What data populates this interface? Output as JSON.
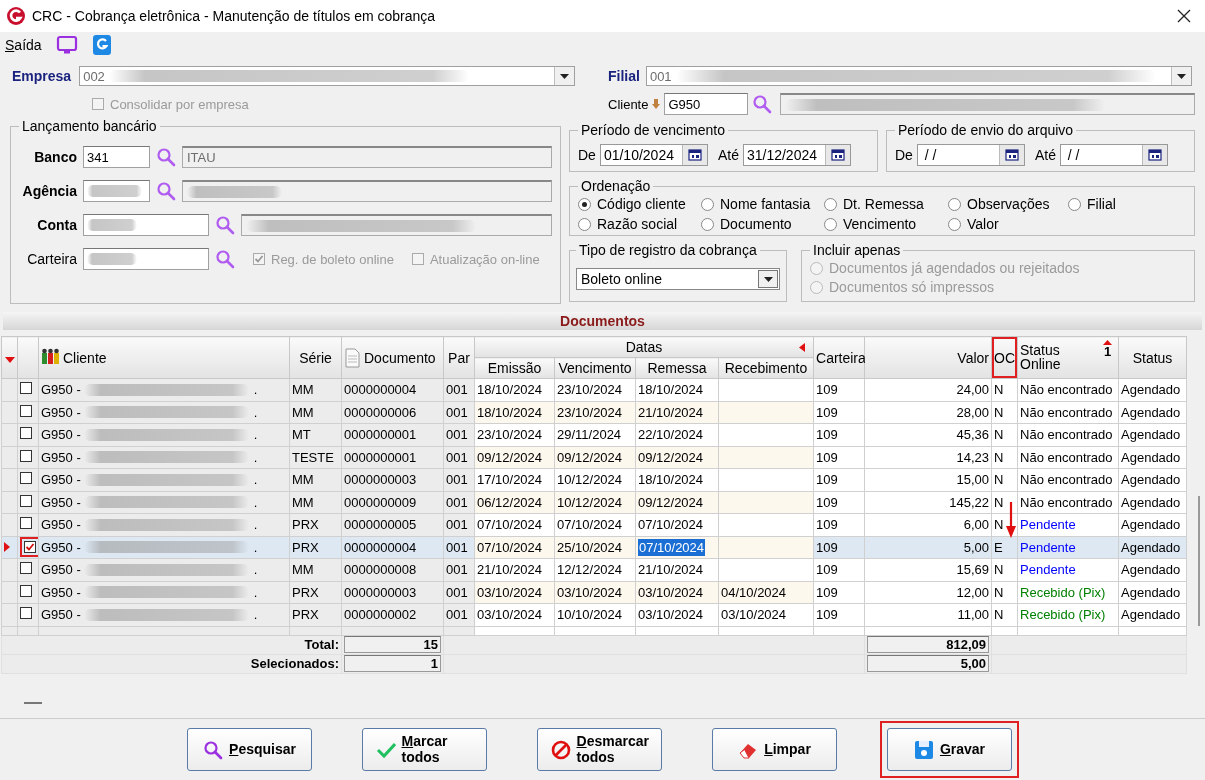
{
  "window": {
    "title": "CRC - Cobrança eletrônica - Manutenção de títulos em cobrança"
  },
  "menu": {
    "items": [
      {
        "label": "Saída",
        "kind": "text"
      },
      {
        "kind": "monitor"
      },
      {
        "kind": "logo"
      }
    ]
  },
  "empresa": {
    "label": "Empresa",
    "value": "002"
  },
  "filial": {
    "label": "Filial",
    "value": "001"
  },
  "consolidar": {
    "label": "Consolidar por empresa",
    "checked": false,
    "disabled": true
  },
  "cliente": {
    "label": "Cliente",
    "value": "G950"
  },
  "lancamento": {
    "title": "Lançamento bancário",
    "fields": [
      {
        "label": "Banco",
        "required": true,
        "value": "341",
        "description": "ITAU"
      },
      {
        "label": "Agência",
        "required": true
      },
      {
        "label": "Conta",
        "required": true
      },
      {
        "label": "Carteira",
        "required": false,
        "options": [
          {
            "label": "Reg. de boleto online",
            "checked": true,
            "disabled": true
          },
          {
            "label": "Atualização on-line",
            "checked": false,
            "disabled": true
          }
        ]
      }
    ]
  },
  "periodos": [
    {
      "title": "Período de vencimento",
      "from_label": "De",
      "from": "01/10/2024",
      "to_label": "Até",
      "to": "31/12/2024"
    },
    {
      "title": "Período de envio do arquivo",
      "from_label": "De",
      "from": " / /",
      "to_label": "Até",
      "to": " / /"
    }
  ],
  "ordenacao": {
    "title": "Ordenação",
    "options": [
      {
        "label": "Código cliente",
        "selected": true
      },
      {
        "label": "Nome fantasia",
        "selected": false
      },
      {
        "label": "Dt. Remessa",
        "selected": false
      },
      {
        "label": "Observações",
        "selected": false
      },
      {
        "label": "Filial",
        "selected": false
      },
      {
        "label": "Razão social",
        "selected": false
      },
      {
        "label": "Documento",
        "selected": false
      },
      {
        "label": "Vencimento",
        "selected": false
      },
      {
        "label": "Valor",
        "selected": false
      }
    ]
  },
  "tipo_registro": {
    "title": "Tipo de registro da cobrança",
    "value": "Boleto online"
  },
  "incluir_apenas": {
    "title": "Incluir apenas",
    "options": [
      {
        "label": "Documentos já agendados ou rejeitados",
        "selected": false,
        "disabled": true
      },
      {
        "label": "Documentos só impressos",
        "selected": false,
        "disabled": true
      }
    ]
  },
  "documentos": {
    "title": "Documentos",
    "columns": [
      {
        "label": "Cliente"
      },
      {
        "label": "Série"
      },
      {
        "label": "Documento"
      },
      {
        "label": "Par"
      },
      {
        "label": "Datas",
        "children": [
          {
            "label": "Emissão"
          },
          {
            "label": "Vencimento"
          },
          {
            "label": "Remessa"
          },
          {
            "label": "Recebimento"
          }
        ]
      },
      {
        "label": "Carteira"
      },
      {
        "label": "Valor"
      },
      {
        "label": "OC",
        "highlighted": true
      },
      {
        "label": "Status Online",
        "sort": "1"
      },
      {
        "label": "Status"
      }
    ],
    "rows": [
      {
        "checked": false,
        "selected": false,
        "highlighted": false,
        "client": "G950 -",
        "client_tail": ".",
        "serie": "MM",
        "documento": "0000000004",
        "par": "001",
        "emissao": "18/10/2024",
        "vencimento": "23/10/2024",
        "remessa": "18/10/2024",
        "carteira": "109",
        "valor": "24,00",
        "oc": "N",
        "status_online": "Não encontrado",
        "color": "#000000",
        "status": "Agendado"
      },
      {
        "checked": false,
        "selected": false,
        "highlighted": false,
        "client": "G950 -",
        "client_tail": ".",
        "serie": "MM",
        "documento": "0000000006",
        "par": "001",
        "emissao": "18/10/2024",
        "vencimento": "23/10/2024",
        "remessa": "21/10/2024",
        "carteira": "109",
        "valor": "28,00",
        "oc": "N",
        "status_online": "Não encontrado",
        "color": "#000000",
        "status": "Agendado"
      },
      {
        "checked": false,
        "selected": false,
        "highlighted": false,
        "client": "G950 -",
        "client_tail": ".",
        "serie": "MT",
        "documento": "0000000001",
        "par": "001",
        "emissao": "23/10/2024",
        "vencimento": "29/11/2024",
        "remessa": "22/10/2024",
        "carteira": "109",
        "valor": "45,36",
        "oc": "N",
        "status_online": "Não encontrado",
        "color": "#000000",
        "status": "Agendado"
      },
      {
        "checked": false,
        "selected": false,
        "highlighted": false,
        "client": "G950 -",
        "client_tail": ".",
        "serie": "TESTE",
        "documento": "0000000001",
        "par": "001",
        "emissao": "09/12/2024",
        "vencimento": "09/12/2024",
        "remessa": "09/12/2024",
        "carteira": "109",
        "valor": "14,23",
        "oc": "N",
        "status_online": "Não encontrado",
        "color": "#000000",
        "status": "Agendado"
      },
      {
        "checked": false,
        "selected": false,
        "highlighted": false,
        "client": "G950 -",
        "client_tail": ".",
        "serie": "MM",
        "documento": "0000000003",
        "par": "001",
        "emissao": "17/10/2024",
        "vencimento": "10/12/2024",
        "remessa": "18/10/2024",
        "carteira": "109",
        "valor": "15,00",
        "oc": "N",
        "status_online": "Não encontrado",
        "color": "#000000",
        "status": "Agendado"
      },
      {
        "checked": false,
        "selected": false,
        "highlighted": false,
        "client": "G950 -",
        "client_tail": ".",
        "serie": "MM",
        "documento": "0000000009",
        "par": "001",
        "emissao": "06/12/2024",
        "vencimento": "10/12/2024",
        "remessa": "09/12/2024",
        "carteira": "109",
        "valor": "145,22",
        "oc": "N",
        "status_online": "Não encontrado",
        "color": "#000000",
        "status": "Agendado"
      },
      {
        "checked": false,
        "selected": false,
        "highlighted": false,
        "client": "G950 -",
        "client_tail": ".",
        "serie": "PRX",
        "documento": "0000000005",
        "par": "001",
        "emissao": "07/10/2024",
        "vencimento": "07/10/2024",
        "remessa": "07/10/2024",
        "carteira": "109",
        "valor": "6,00",
        "oc": "N",
        "status_online": "Pendente",
        "color": "#0000ff",
        "status": "Agendado"
      },
      {
        "checked": true,
        "selected": true,
        "highlighted": true,
        "focused": true,
        "client": "G950 -",
        "client_tail": ".",
        "serie": "PRX",
        "documento": "0000000004",
        "par": "001",
        "emissao": "07/10/2024",
        "vencimento": "25/10/2024",
        "remessa": "07/10/2024",
        "carteira": "109",
        "valor": "5,00",
        "oc": "E",
        "status_online": "Pendente",
        "color": "#0000ff",
        "status": "Agendado"
      },
      {
        "checked": false,
        "selected": false,
        "highlighted": false,
        "client": "G950 -",
        "client_tail": ".",
        "serie": "MM",
        "documento": "0000000008",
        "par": "001",
        "emissao": "21/10/2024",
        "vencimento": "12/12/2024",
        "remessa": "21/10/2024",
        "carteira": "109",
        "valor": "15,69",
        "oc": "N",
        "status_online": "Pendente",
        "color": "#0000ff",
        "status": "Agendado"
      },
      {
        "checked": false,
        "selected": false,
        "highlighted": false,
        "client": "G950 -",
        "client_tail": ".",
        "serie": "PRX",
        "documento": "0000000003",
        "par": "001",
        "emissao": "03/10/2024",
        "vencimento": "03/10/2024",
        "remessa": "03/10/2024",
        "recebimento": "04/10/2024",
        "carteira": "109",
        "valor": "12,00",
        "oc": "N",
        "status_online": "Recebido (Pix)",
        "color": "#008000",
        "status": "Agendado"
      },
      {
        "checked": false,
        "selected": false,
        "highlighted": false,
        "client": "G950 -",
        "client_tail": ".",
        "serie": "PRX",
        "documento": "0000000002",
        "par": "001",
        "emissao": "03/10/2024",
        "vencimento": "10/10/2024",
        "remessa": "03/10/2024",
        "recebimento": "03/10/2024",
        "carteira": "109",
        "valor": "11,00",
        "oc": "N",
        "status_online": "Recebido (Pix)",
        "color": "#008000",
        "status": "Agendado"
      }
    ],
    "totals": [
      {
        "label": "Total:",
        "count": "15",
        "amount": "812,09"
      },
      {
        "label": "Selecionados:",
        "count": "1",
        "amount": "5,00"
      }
    ]
  },
  "buttons": [
    {
      "label": "Pesquisar",
      "kind": "search",
      "highlighted": false
    },
    {
      "label": "Marcar todos",
      "kind": "check",
      "highlighted": false
    },
    {
      "label": "Desmarcar todos",
      "kind": "forbid",
      "highlighted": false
    },
    {
      "label": "Limpar",
      "kind": "eraser",
      "highlighted": false
    },
    {
      "label": "Gravar",
      "kind": "save",
      "highlighted": true
    }
  ]
}
